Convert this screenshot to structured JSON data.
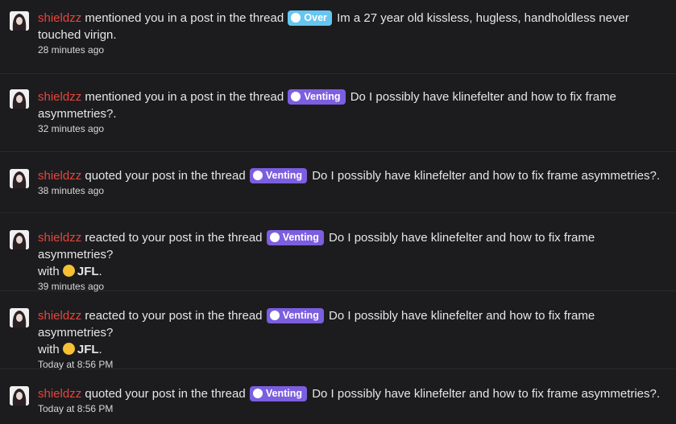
{
  "notifications": [
    {
      "user": "shieldzz",
      "action": "mentioned you in a post in the thread",
      "prefix": "Over",
      "prefix_color": "#67c6f0",
      "title": "Im a 27 year old kissless, hugless, handholdless never touched virign.",
      "time": "28 minutes ago"
    },
    {
      "user": "shieldzz",
      "action": "mentioned you in a post in the thread",
      "prefix": "Venting",
      "prefix_color": "#7c5ee0",
      "title": "Do I possibly have klinefelter and how to fix frame asymmetries?.",
      "time": "32 minutes ago"
    },
    {
      "user": "shieldzz",
      "action": "quoted your post in the thread",
      "prefix": "Venting",
      "prefix_color": "#7c5ee0",
      "title": "Do I possibly have klinefelter and how to fix frame asymmetries?.",
      "time": "38 minutes ago"
    },
    {
      "user": "shieldzz",
      "action": "reacted to your post in the thread",
      "prefix": "Venting",
      "prefix_color": "#7c5ee0",
      "title": "Do I possibly have klinefelter and how to fix frame asymmetries?",
      "with_label": "with",
      "reaction": "JFL",
      "reaction_icon": "tears-of-joy-emoji",
      "time": "39 minutes ago"
    },
    {
      "user": "shieldzz",
      "action": "reacted to your post in the thread",
      "prefix": "Venting",
      "prefix_color": "#7c5ee0",
      "title": "Do I possibly have klinefelter and how to fix frame asymmetries?",
      "with_label": "with",
      "reaction": "JFL",
      "reaction_icon": "tears-of-joy-emoji",
      "time": "Today at 8:56 PM"
    },
    {
      "user": "shieldzz",
      "action": "quoted your post in the thread",
      "prefix": "Venting",
      "prefix_color": "#7c5ee0",
      "title": "Do I possibly have klinefelter and how to fix frame asymmetries?.",
      "time": "Today at 8:56 PM"
    }
  ]
}
